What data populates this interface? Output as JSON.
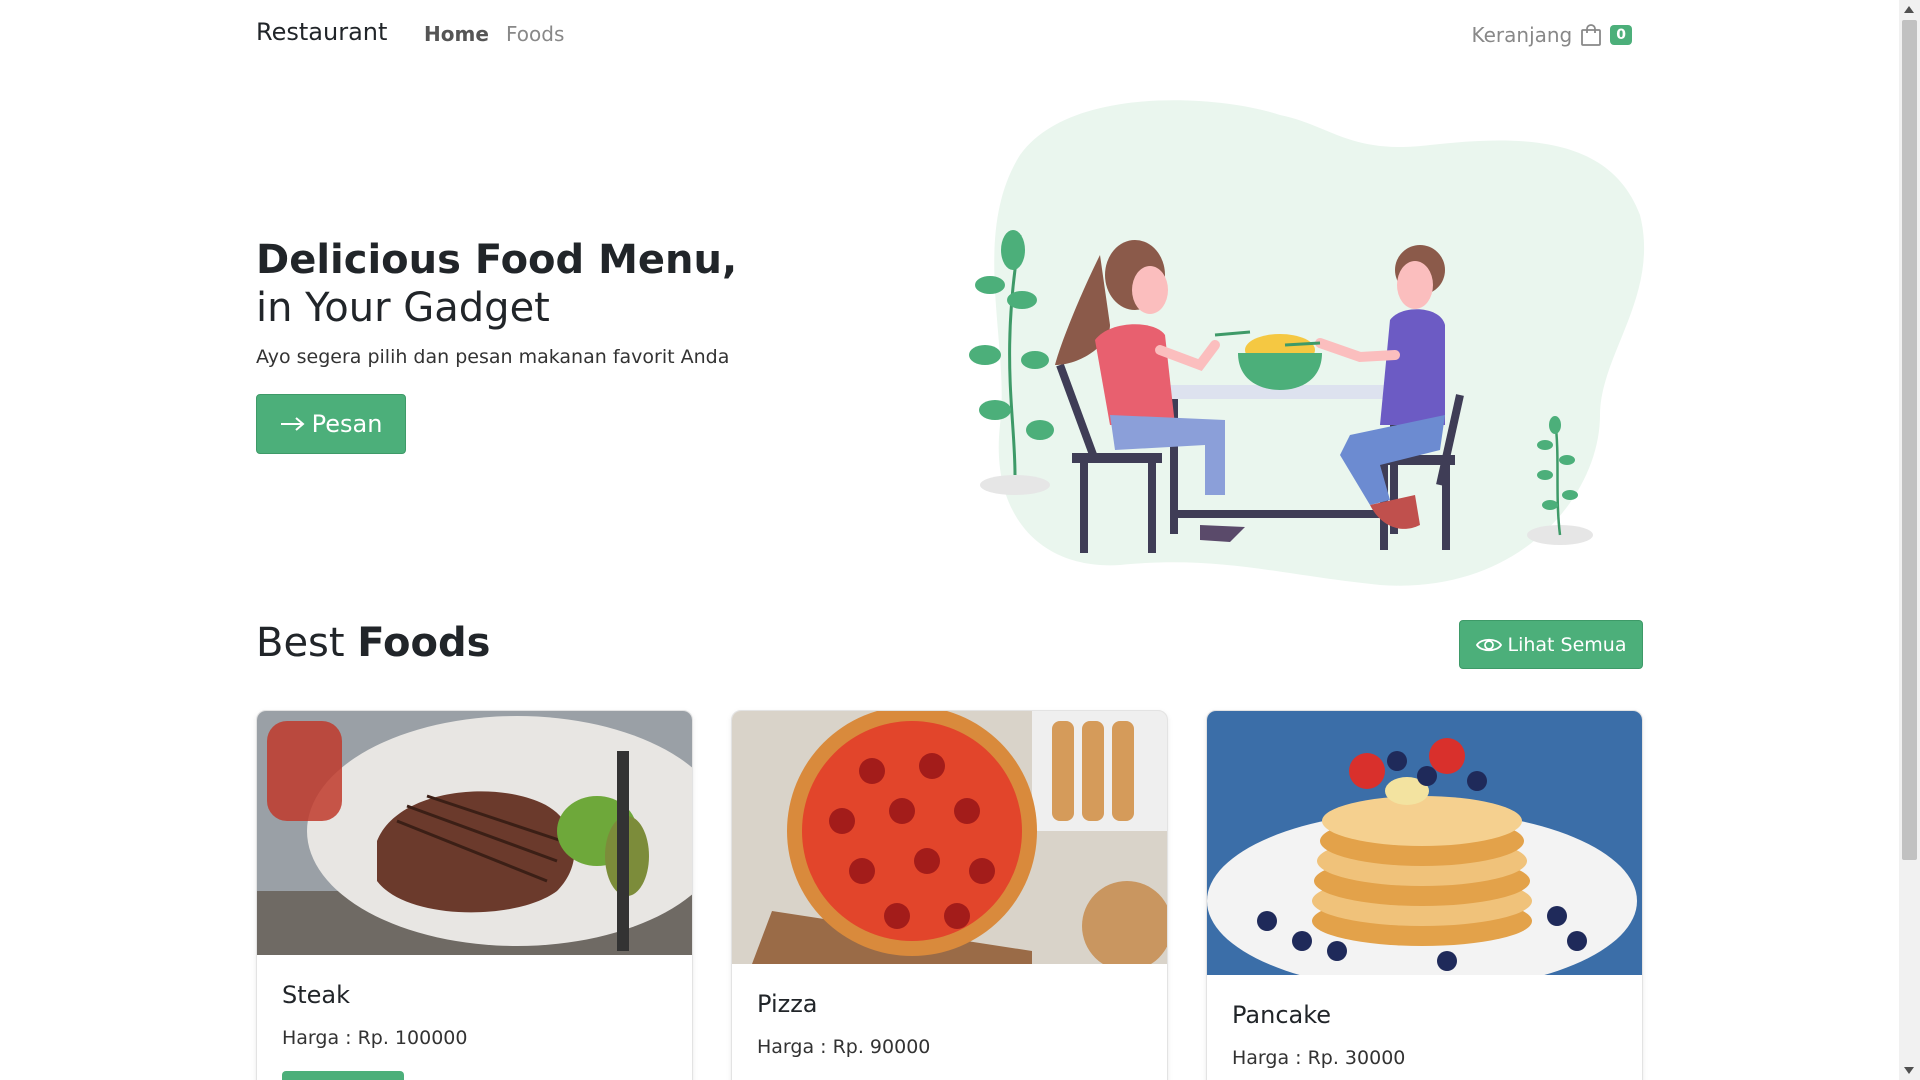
{
  "navbar": {
    "brand": "Restaurant",
    "links": [
      {
        "label": "Home",
        "active": true
      },
      {
        "label": "Foods",
        "active": false
      }
    ],
    "cart_label": "Keranjang",
    "cart_count": "0",
    "cart_icon": "shopping-bag-icon"
  },
  "hero": {
    "title": "Delicious Food Menu,",
    "subtitle": "in Your Gadget",
    "text": "Ayo segera pilih dan pesan makanan favorit Anda",
    "button_label": "Pesan",
    "button_icon": "arrow-right-icon"
  },
  "best_foods": {
    "title_light": "Best",
    "title_bold": "Foods",
    "view_all_label": "Lihat Semua",
    "view_all_icon": "eye-icon",
    "items": [
      {
        "name": "Steak",
        "price": "Harga : Rp. 100000"
      },
      {
        "name": "Pizza",
        "price": "Harga : Rp. 90000"
      },
      {
        "name": "Pancake",
        "price": "Harga : Rp. 30000"
      }
    ]
  },
  "colors": {
    "accent": "#4caf7a",
    "text": "#212529",
    "muted": "#888888"
  }
}
